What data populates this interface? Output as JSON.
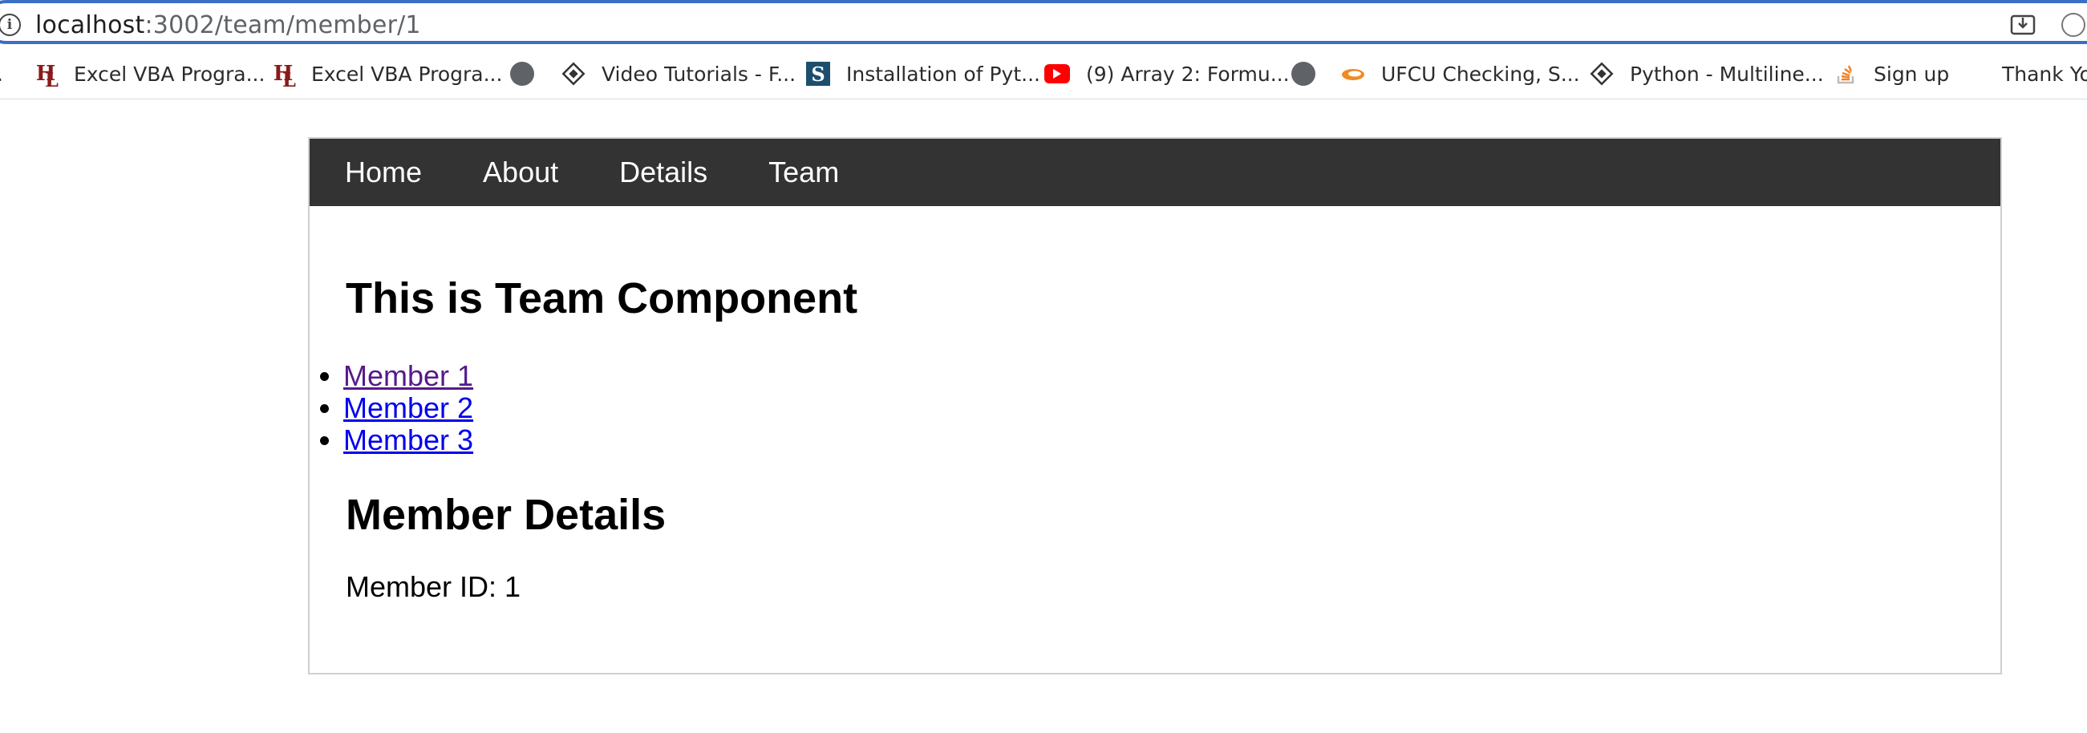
{
  "browser": {
    "url_host": "localhost",
    "url_path": ":3002/team/member/1",
    "bookmarks": [
      {
        "label": "Excel VBA Progra...",
        "icon": "hl-icon"
      },
      {
        "label": "Excel VBA Progra...",
        "icon": "hl-icon"
      },
      {
        "label": "",
        "icon": "globe-icon"
      },
      {
        "label": "Video Tutorials - F...",
        "icon": "diamond-icon"
      },
      {
        "label": "Installation of Pyt...",
        "icon": "s-icon"
      },
      {
        "label": "(9) Array 2: Formu...",
        "icon": "youtube-icon"
      },
      {
        "label": "",
        "icon": "globe-icon"
      },
      {
        "label": "UFCU Checking, S...",
        "icon": "ufcu-icon"
      },
      {
        "label": "Python - Multiline...",
        "icon": "diamond-icon"
      },
      {
        "label": "Sign up",
        "icon": "stack-icon"
      },
      {
        "label": "Thank Yo",
        "icon": ""
      }
    ]
  },
  "nav": {
    "home": "Home",
    "about": "About",
    "details": "Details",
    "team": "Team"
  },
  "team": {
    "heading": "This is Team Component",
    "members": [
      "Member 1",
      "Member 2",
      "Member 3"
    ]
  },
  "details": {
    "heading": "Member Details",
    "member_id": "Member ID: 1"
  }
}
